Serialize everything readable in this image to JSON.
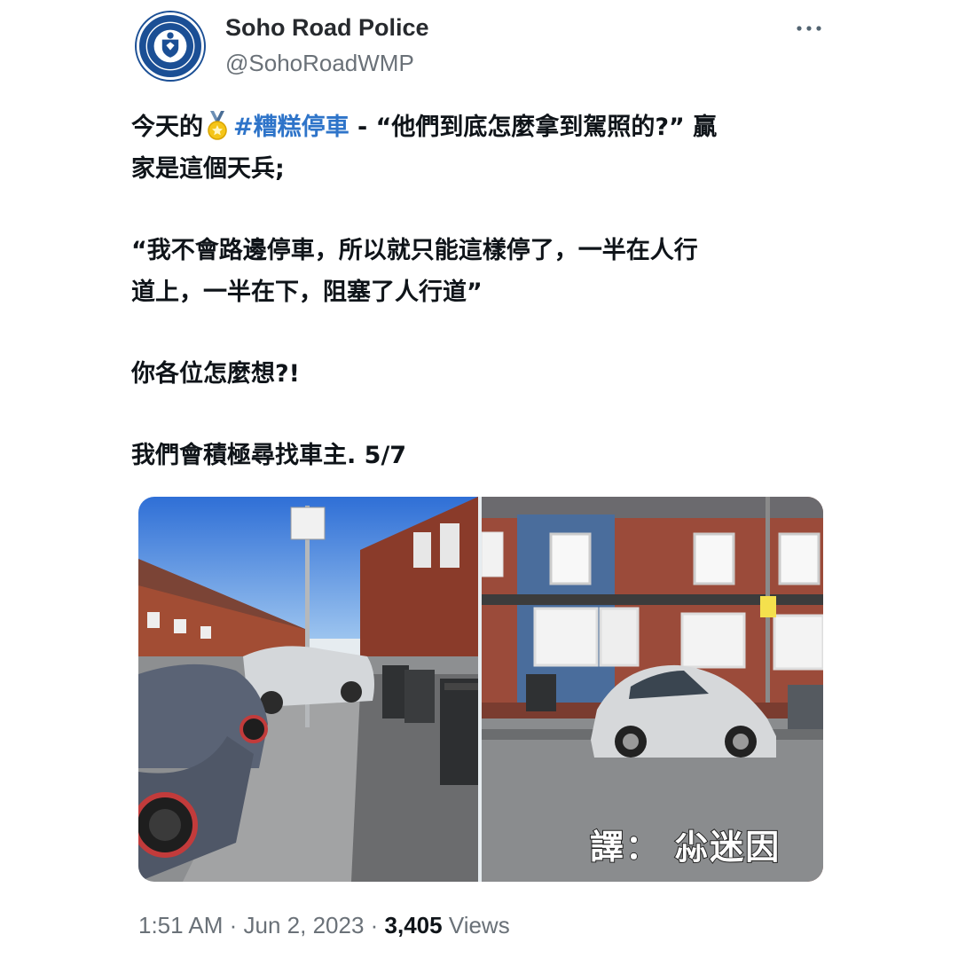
{
  "author": {
    "name": "Soho Road Police",
    "handle": "@SohoRoadWMP",
    "avatar_emblem_text": "WEST MIDLANDS POLICE"
  },
  "more_icon": "more-horizontal-icon",
  "tweet": {
    "line1_prefix": "今天的",
    "medal_icon": "medal-icon",
    "hashtag": "#糟糕停車",
    "line1_suffix": " - “他們到底怎麼拿到駕照的?” 贏",
    "line2": "家是這個天兵;",
    "line3": "“我不會路邊停車，所以就只能這樣停了，一半在人行",
    "line4": "道上，一半在下，阻塞了人行道”",
    "line5": "你各位怎麼想?!",
    "line6": "我們會積極尋找車主. 5/7"
  },
  "media": {
    "watermark": "譯： 尛迷因"
  },
  "meta": {
    "time": "1:51 AM",
    "separator1": " · ",
    "date": "Jun 2, 2023",
    "separator2": " · ",
    "views_count": "3,405",
    "views_label": " Views"
  },
  "colors": {
    "hashtag": "#2e74c9",
    "secondary_text": "#6a7178",
    "avatar_blue": "#1b4f95"
  }
}
